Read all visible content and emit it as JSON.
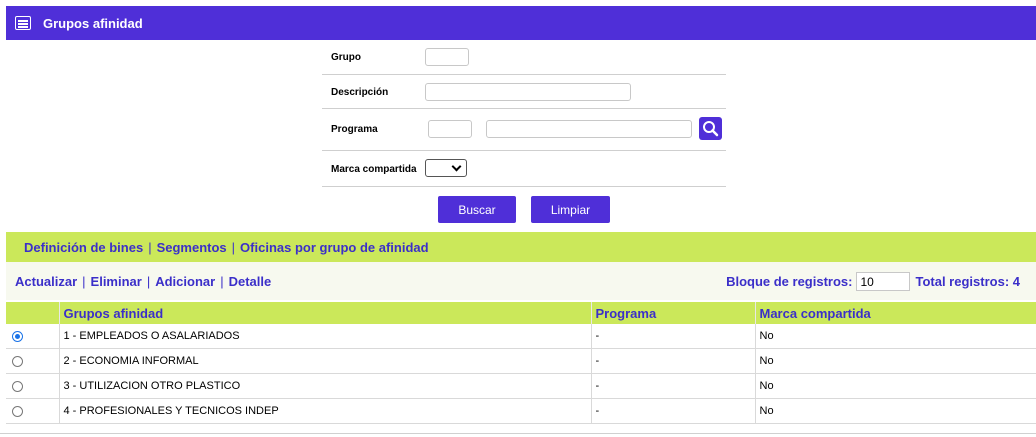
{
  "header": {
    "title": "Grupos afinidad",
    "icon": "list-icon"
  },
  "form": {
    "grupo_label": "Grupo",
    "grupo_value": "",
    "descripcion_label": "Descripción",
    "descripcion_value": "",
    "programa_label": "Programa",
    "programa_code": "",
    "programa_name": "",
    "marca_label": "Marca compartida",
    "marca_value": ""
  },
  "buttons": {
    "buscar": "Buscar",
    "limpiar": "Limpiar"
  },
  "links": [
    "Definición de bines",
    "Segmentos",
    "Oficinas por grupo de afinidad"
  ],
  "toolbar": {
    "actions": [
      "Actualizar",
      "Eliminar",
      "Adicionar",
      "Detalle"
    ],
    "block_label": "Bloque de registros:",
    "block_value": "10",
    "total_label": "Total registros: 4"
  },
  "table": {
    "columns": [
      "",
      "Grupos afinidad",
      "Programa",
      "Marca compartida"
    ],
    "rows": [
      {
        "selected": true,
        "grupo": "1 - EMPLEADOS O ASALARIADOS",
        "programa": "-",
        "marca": "No"
      },
      {
        "selected": false,
        "grupo": "2 - ECONOMIA INFORMAL",
        "programa": "-",
        "marca": "No"
      },
      {
        "selected": false,
        "grupo": "3 - UTILIZACION OTRO PLASTICO",
        "programa": "-",
        "marca": "No"
      },
      {
        "selected": false,
        "grupo": "4 - PROFESIONALES Y TECNICOS INDEP",
        "programa": "-",
        "marca": "No"
      }
    ]
  },
  "colors": {
    "primary": "#4f2fd8",
    "accent": "#cbe85a",
    "link": "#3b2fc9"
  }
}
